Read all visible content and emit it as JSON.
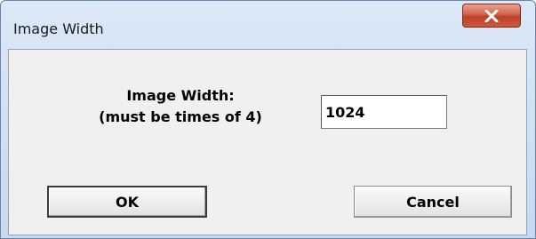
{
  "window": {
    "title": "Image Width",
    "close_icon": "close-icon"
  },
  "dialog": {
    "prompt_line1": "Image Width:",
    "prompt_line2": "(must be times of 4)",
    "width_value": "1024",
    "ok_label": "OK",
    "cancel_label": "Cancel"
  },
  "colors": {
    "titlebar": "#c8d9ee",
    "close_button": "#c8472f",
    "client_bg": "#f0f0f0"
  }
}
